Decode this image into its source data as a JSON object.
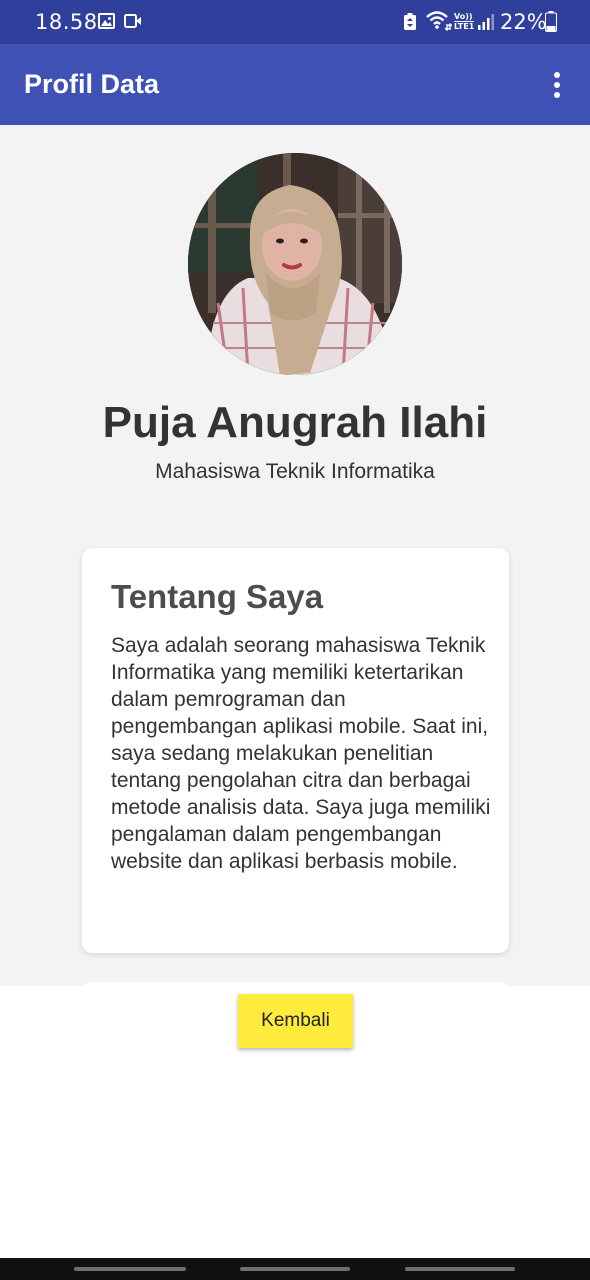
{
  "status_bar": {
    "time": "18.58",
    "volte_top": "Vo))",
    "volte_bottom": "LTE1",
    "battery_pct": "22%",
    "icons": [
      "gallery-icon",
      "video-icon",
      "battery-saver-icon",
      "wifi-icon",
      "volte-icon",
      "signal-icon",
      "battery-icon"
    ]
  },
  "app_bar": {
    "title": "Profil Data",
    "menu_icon": "more-vert-icon"
  },
  "profile": {
    "name": "Puja Anugrah Ilahi",
    "role": "Mahasiswa Teknik Informatika"
  },
  "about": {
    "title": "Tentang Saya",
    "body": "Saya adalah seorang mahasiswa Teknik Informatika yang memiliki ketertarikan dalam pemrograman dan pengembangan aplikasi mobile. Saat ini, saya sedang melakukan penelitian tentang pengolahan citra dan berbagai metode analisis data. Saya juga memiliki pengalaman dalam pengembangan website dan aplikasi berbasis mobile."
  },
  "actions": {
    "back_label": "Kembali"
  },
  "colors": {
    "status_bar": "#2f3f9b",
    "app_bar": "#3f51b5",
    "background": "#f3f3f3",
    "button": "#ffeb3b"
  }
}
